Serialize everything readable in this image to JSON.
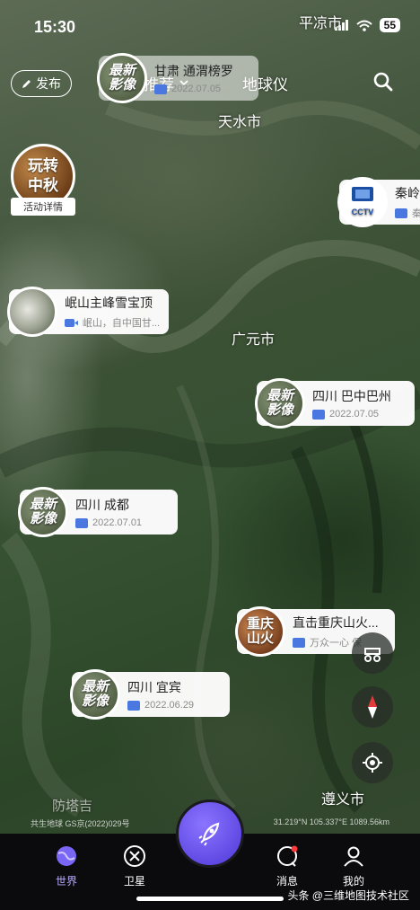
{
  "status_bar": {
    "time": "15:30",
    "battery": "55"
  },
  "top_bar": {
    "publish_label": "发布",
    "tab_recommend": "推荐",
    "tab_globe": "地球仪"
  },
  "cities": {
    "pingliang": "平凉市",
    "tianshui": "天水市",
    "guangyuan": "广元市",
    "zunyi": "遵义市",
    "bottom": "防塔吉"
  },
  "event_badge": {
    "title_line1": "玩转",
    "title_line2": "中秋",
    "label": "活动详情"
  },
  "cards": [
    {
      "thumb_line1": "最新",
      "thumb_line2": "影像",
      "title": "甘肃 通渭榜罗",
      "date": "2022.07.05"
    },
    {
      "thumb_text": "CCTV",
      "title": "秦岭",
      "sub": "秦"
    },
    {
      "title": "岷山主峰雪宝顶",
      "sub": "岷山，自中国甘..."
    },
    {
      "thumb_line1": "最新",
      "thumb_line2": "影像",
      "title": "四川 巴中巴州",
      "date": "2022.07.05"
    },
    {
      "thumb_line1": "最新",
      "thumb_line2": "影像",
      "title": "四川 成都",
      "date": "2022.07.01"
    },
    {
      "thumb_line1": "重庆",
      "thumb_line2": "山火",
      "title": "直击重庆山火...",
      "sub": "万众一心 保"
    },
    {
      "thumb_line1": "最新",
      "thumb_line2": "影像",
      "title": "四川 宜宾",
      "date": "2022.06.29"
    }
  ],
  "map_footer": {
    "left": "共生地球 GS京(2022)029号",
    "right": "31.219°N 105.337°E 1089.56km"
  },
  "nav": {
    "world": "世界",
    "satellite": "卫星",
    "messages": "消息",
    "mine": "我的"
  },
  "watermark": "头条 @三维地图技术社区",
  "colors": {
    "accent": "#6b55f0",
    "nav_bg": "#0b0b0d"
  }
}
